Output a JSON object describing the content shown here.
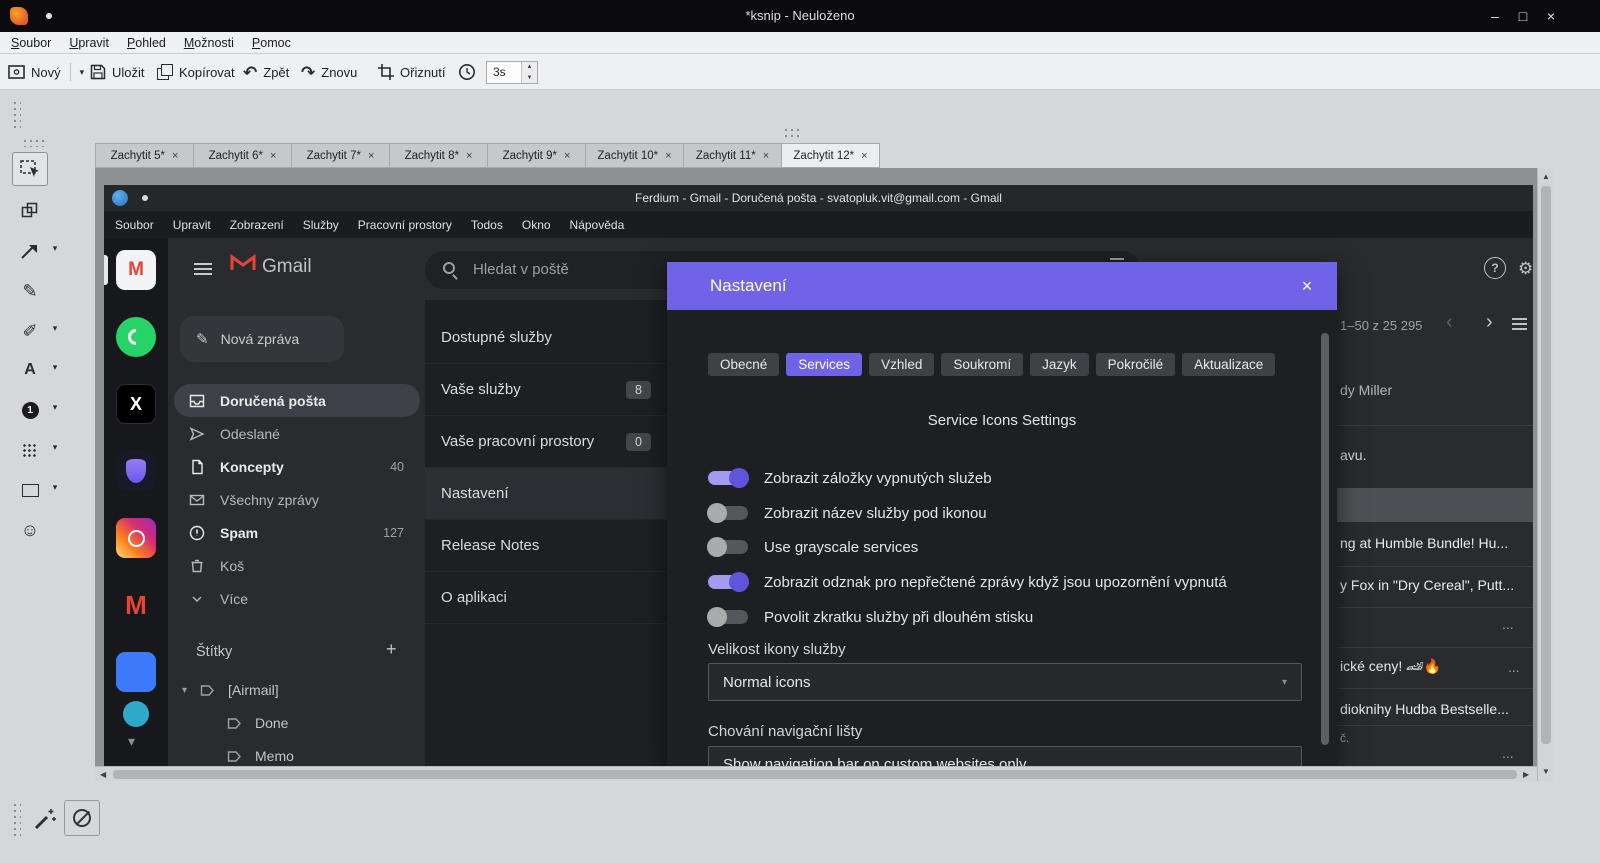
{
  "colors": {
    "accent_purple": "#6f64e8",
    "toggle_on_knob": "#6054dd",
    "ksnip_titlebar": "#0b0b0d",
    "canvas_gray": "#8f9193",
    "dialog_bg": "#1e1f22",
    "whatsapp_green": "#25d366",
    "gmail_red": "#ea4335",
    "service_blue": "#3e7bfa"
  },
  "icons": {
    "caret_down": "▾",
    "close": "×",
    "minimize": "–",
    "maximize": "□",
    "undo": "↶",
    "redo": "↷",
    "pencil": "✎",
    "marker": "✐",
    "text_tool": "A",
    "number_tool": "1",
    "emoji_tool": "☺",
    "plus": "+",
    "question": "?",
    "gear": "⚙",
    "chevron_left": "‹",
    "chevron_right": "›",
    "up": "▲",
    "down": "▼",
    "left": "◀",
    "right": "▶",
    "x_logo": "X",
    "gmail_m": "M"
  },
  "ksnip": {
    "titlebar": {
      "title": "*ksnip - Neuloženo"
    },
    "menu": [
      {
        "k": "S",
        "rest": "oubor"
      },
      {
        "k": "U",
        "rest": "pravit"
      },
      {
        "k": "P",
        "rest": "ohled"
      },
      {
        "k": "M",
        "rest": "ožnosti"
      },
      {
        "k": "P",
        "rest": "omoc"
      }
    ],
    "toolbar": {
      "new": "Nový",
      "save": "Uložit",
      "copy": "Kopírovat",
      "undo": "Zpět",
      "redo": "Znovu",
      "crop": "Ořiznutí",
      "delay": "3s"
    },
    "tabs": [
      {
        "label": "Zachytit 5*"
      },
      {
        "label": "Zachytit 6*"
      },
      {
        "label": "Zachytit 7*"
      },
      {
        "label": "Zachytit 8*"
      },
      {
        "label": "Zachytit 9*"
      },
      {
        "label": "Zachytit 10*"
      },
      {
        "label": "Zachytit 11*"
      },
      {
        "label": "Zachytit 12*"
      }
    ],
    "active_tab": "Zachytit 12*"
  },
  "ferdium": {
    "titlebar_title": "Ferdium - Gmail - Doručená pošta - svatopluk.vit@gmail.com - Gmail",
    "menu": [
      "Soubor",
      "Upravit",
      "Zobrazení",
      "Služby",
      "Pracovní prostory",
      "Todos",
      "Okno",
      "Nápověda"
    ],
    "settings_nav": [
      {
        "label": "Dostupné služby",
        "badge": ""
      },
      {
        "label": "Vaše služby",
        "badge": "8"
      },
      {
        "label": "Vaše pracovní prostory",
        "badge": "0"
      },
      {
        "label": "Nastavení",
        "badge": ""
      },
      {
        "label": "Release Notes",
        "badge": ""
      },
      {
        "label": "O aplikaci",
        "badge": ""
      }
    ],
    "settings_nav_selected": "Nastavení",
    "dialog": {
      "title": "Nastavení",
      "tabs": [
        {
          "label": "Obecné"
        },
        {
          "label": "Services"
        },
        {
          "label": "Vzhled"
        },
        {
          "label": "Soukromí"
        },
        {
          "label": "Jazyk"
        },
        {
          "label": "Pokročilé"
        },
        {
          "label": "Aktualizace"
        }
      ],
      "active_tab": "Services",
      "section_title": "Service Icons Settings",
      "toggles": [
        {
          "label": "Zobrazit záložky vypnutých služeb",
          "on": true
        },
        {
          "label": "Zobrazit název služby pod ikonou",
          "on": false
        },
        {
          "label": "Use grayscale services",
          "on": false
        },
        {
          "label": "Zobrazit odznak pro nepřečtené zprávy když jsou upozornění vypnutá",
          "on": true
        },
        {
          "label": "Povolit zkratku služby při dlouhém stisku",
          "on": false
        }
      ],
      "icon_size_label": "Velikost ikony služby",
      "icon_size_value": "Normal icons",
      "navbar_label": "Chování navigační lišty",
      "navbar_value": "Show navigation bar on custom websites only"
    }
  },
  "gmail": {
    "logo_text": "Gmail",
    "search_placeholder": "Hledat v poště",
    "compose": "Nová zpráva",
    "nav": [
      {
        "label": "Doručená pošta",
        "count": ""
      },
      {
        "label": "Odeslané",
        "count": ""
      },
      {
        "label": "Koncepty",
        "count": "40"
      },
      {
        "label": "Všechny zprávy",
        "count": ""
      },
      {
        "label": "Spam",
        "count": "127"
      },
      {
        "label": "Koš",
        "count": ""
      },
      {
        "label": "Více",
        "count": ""
      }
    ],
    "labels_header": "Štítky",
    "labels": [
      {
        "label": "[Airmail]"
      },
      {
        "label": "Done"
      },
      {
        "label": "Memo"
      }
    ],
    "pagination": "1–50 z 25 295",
    "fragments": {
      "sender": "dy Miller",
      "r1": "avu.",
      "r2": "ng at Humble Bundle! Hu...",
      "r3": "y Fox in \"Dry Cereal\", Putt...",
      "r4": "ické ceny! 🏎🔥",
      "r5": "dioknihy Hudba Bestselle...",
      "r6": "č.",
      "dots": "..."
    }
  }
}
